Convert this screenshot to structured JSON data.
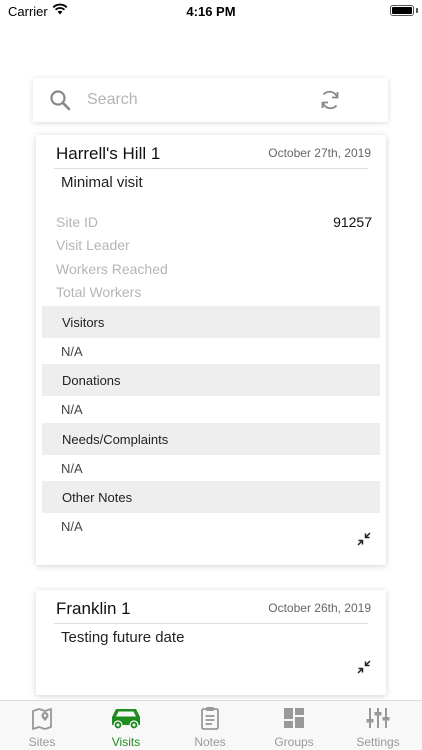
{
  "status_bar": {
    "carrier": "Carrier",
    "time": "4:16 PM"
  },
  "search": {
    "placeholder": "Search"
  },
  "visits": [
    {
      "site": "Harrell's Hill 1",
      "date": "October 27th, 2019",
      "summary": "Minimal visit",
      "fields": [
        {
          "label": "Site ID",
          "value": "91257"
        },
        {
          "label": "Visit Leader",
          "value": ""
        },
        {
          "label": "Workers Reached",
          "value": ""
        },
        {
          "label": "Total Workers",
          "value": ""
        }
      ],
      "sections": [
        {
          "title": "Visitors",
          "value": "N/A"
        },
        {
          "title": "Donations",
          "value": "N/A"
        },
        {
          "title": "Needs/Complaints",
          "value": "N/A"
        },
        {
          "title": "Other Notes",
          "value": "N/A"
        }
      ]
    },
    {
      "site": "Franklin 1",
      "date": "October 26th, 2019",
      "summary": "Testing future date"
    }
  ],
  "tabs": [
    {
      "label": "Sites",
      "icon": "map-icon",
      "active": false
    },
    {
      "label": "Visits",
      "icon": "car-icon",
      "active": true
    },
    {
      "label": "Notes",
      "icon": "clipboard-icon",
      "active": false
    },
    {
      "label": "Groups",
      "icon": "grid-icon",
      "active": false
    },
    {
      "label": "Settings",
      "icon": "sliders-icon",
      "active": false
    }
  ],
  "colors": {
    "accent": "#1e8c1e",
    "inactive": "#999999",
    "label_muted": "#b5b5b5",
    "section_bg": "#eeeeee"
  }
}
